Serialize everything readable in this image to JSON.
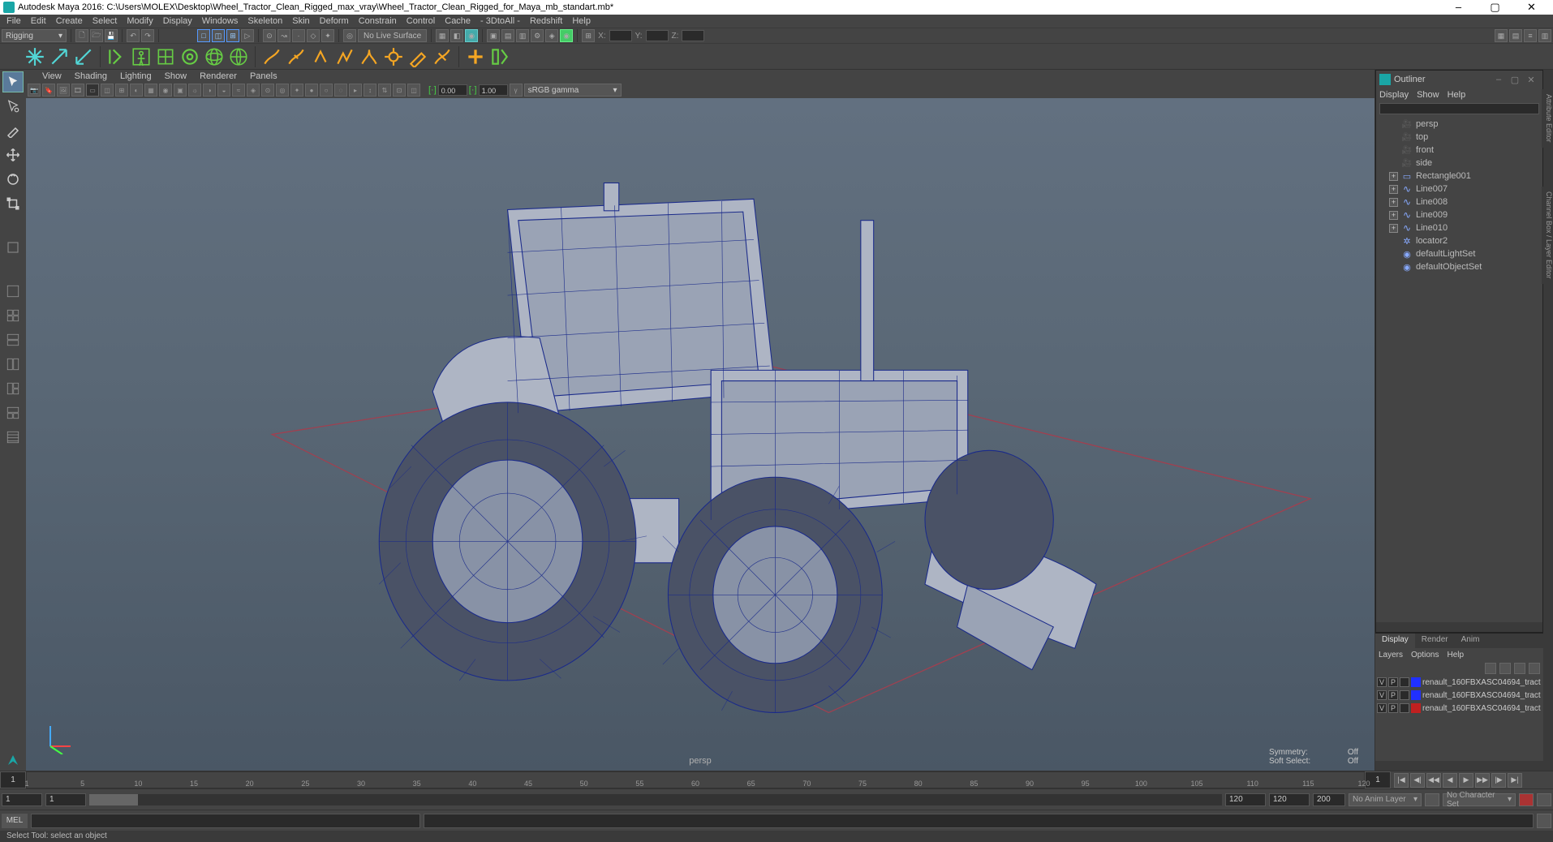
{
  "title": "Autodesk Maya 2016: C:\\Users\\MOLEX\\Desktop\\Wheel_Tractor_Clean_Rigged_max_vray\\Wheel_Tractor_Clean_Rigged_for_Maya_mb_standart.mb*",
  "menubar": [
    "File",
    "Edit",
    "Create",
    "Select",
    "Modify",
    "Display",
    "Windows",
    "Skeleton",
    "Skin",
    "Deform",
    "Constrain",
    "Control",
    "Cache",
    "- 3DtoAll -",
    "Redshift",
    "Help"
  ],
  "module_dropdown": "Rigging",
  "no_live_surface": "No Live Surface",
  "xyz": {
    "x_label": "X:",
    "y_label": "Y:",
    "z_label": "Z:"
  },
  "panel_menu": [
    "View",
    "Shading",
    "Lighting",
    "Show",
    "Renderer",
    "Panels"
  ],
  "panel_toolbar": {
    "near": "0.00",
    "far": "1.00",
    "gamma": "sRGB gamma"
  },
  "viewport": {
    "camera": "persp",
    "symmetry_label": "Symmetry:",
    "symmetry_value": "Off",
    "softselect_label": "Soft Select:",
    "softselect_value": "Off"
  },
  "outliner": {
    "title": "Outliner",
    "menu": [
      "Display",
      "Show",
      "Help"
    ],
    "items": [
      {
        "type": "cam",
        "name": "persp",
        "exp": false
      },
      {
        "type": "cam",
        "name": "top",
        "exp": false
      },
      {
        "type": "cam",
        "name": "front",
        "exp": false
      },
      {
        "type": "cam",
        "name": "side",
        "exp": false
      },
      {
        "type": "rect",
        "name": "Rectangle001",
        "exp": true
      },
      {
        "type": "curve",
        "name": "Line007",
        "exp": true
      },
      {
        "type": "curve",
        "name": "Line008",
        "exp": true
      },
      {
        "type": "curve",
        "name": "Line009",
        "exp": true
      },
      {
        "type": "curve",
        "name": "Line010",
        "exp": true
      },
      {
        "type": "loc",
        "name": "locator2",
        "exp": false
      },
      {
        "type": "set",
        "name": "defaultLightSet",
        "exp": false
      },
      {
        "type": "set",
        "name": "defaultObjectSet",
        "exp": false
      }
    ]
  },
  "layers": {
    "tabs": [
      "Display",
      "Render",
      "Anim"
    ],
    "active_tab": 0,
    "menu": [
      "Layers",
      "Options",
      "Help"
    ],
    "rows": [
      {
        "v": "V",
        "p": "P",
        "c": "#2030ff",
        "name": "renault_160FBXASC04694_tract"
      },
      {
        "v": "V",
        "p": "P",
        "c": "#2030ff",
        "name": "renault_160FBXASC04694_tract"
      },
      {
        "v": "V",
        "p": "P",
        "c": "#c02020",
        "name": "renault_160FBXASC04694_tract"
      }
    ]
  },
  "timeline": {
    "current": "1",
    "ticks": [
      "1",
      "5",
      "10",
      "15",
      "20",
      "25",
      "30",
      "35",
      "40",
      "45",
      "50",
      "55",
      "60",
      "65",
      "70",
      "75",
      "80",
      "85",
      "90",
      "95",
      "100",
      "105",
      "110",
      "115",
      "120"
    ],
    "end_current": "1"
  },
  "range": {
    "start_outer": "1",
    "start_inner": "1",
    "end_inner": "120",
    "end_outer": "120",
    "fps": "200",
    "anim_layer": "No Anim Layer",
    "char_set": "No Character Set"
  },
  "cmd": {
    "lang": "MEL"
  },
  "status": "Select Tool: select an object"
}
